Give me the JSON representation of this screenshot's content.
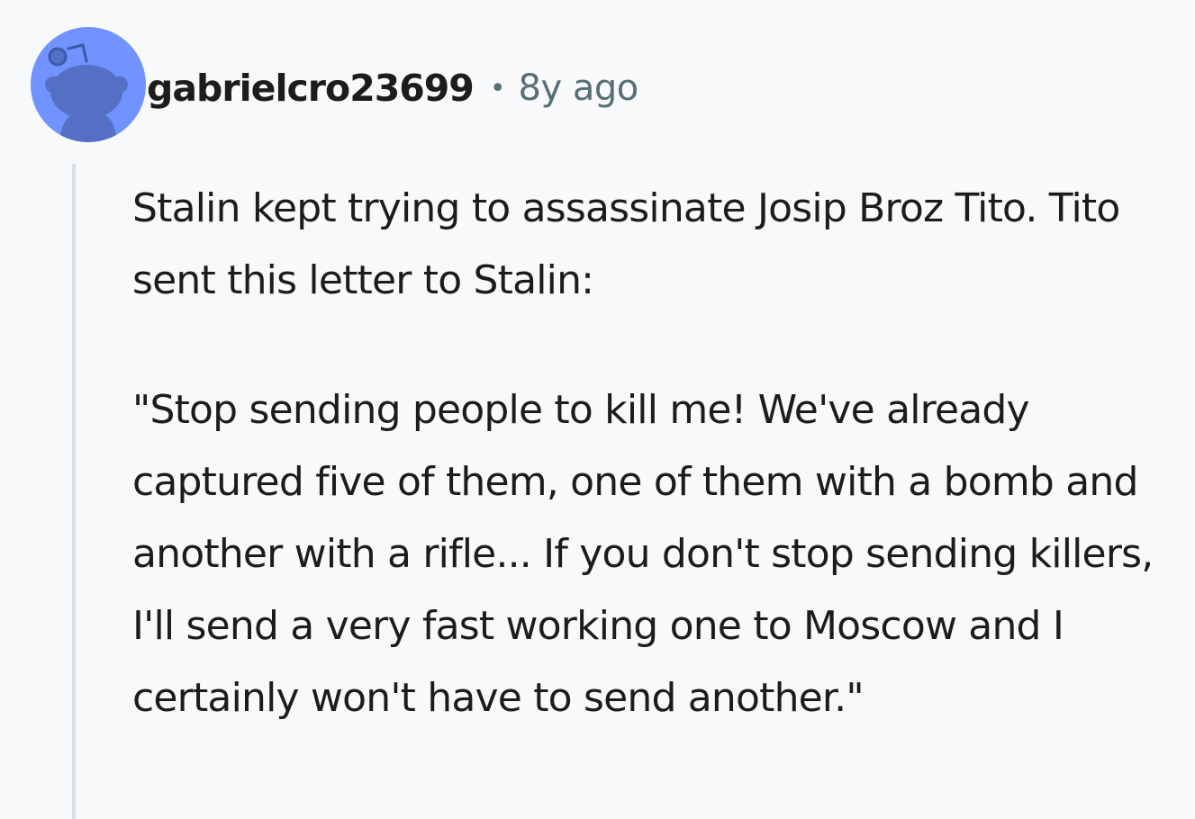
{
  "comment": {
    "author": "gabrielcro23699",
    "separator": "•",
    "timestamp": "8y ago",
    "avatar_icon": "snoo-avatar-icon",
    "paragraphs": [
      "Stalin kept trying to assassinate Josip Broz Tito. Tito sent this letter to Stalin:",
      "\"Stop sending people to kill me! We've already captured five of them, one of them with a bomb and another with a rifle... If you don't stop sending killers, I'll send a very fast working one to Moscow and I certainly won't have to send another.\""
    ]
  },
  "colors": {
    "background": "#f7f9fa",
    "avatar_bg": "#7193ff",
    "avatar_figure": "#5470c4",
    "text": "#1c1c1c",
    "meta": "#576f76",
    "thread_line": "#dae0e6"
  }
}
